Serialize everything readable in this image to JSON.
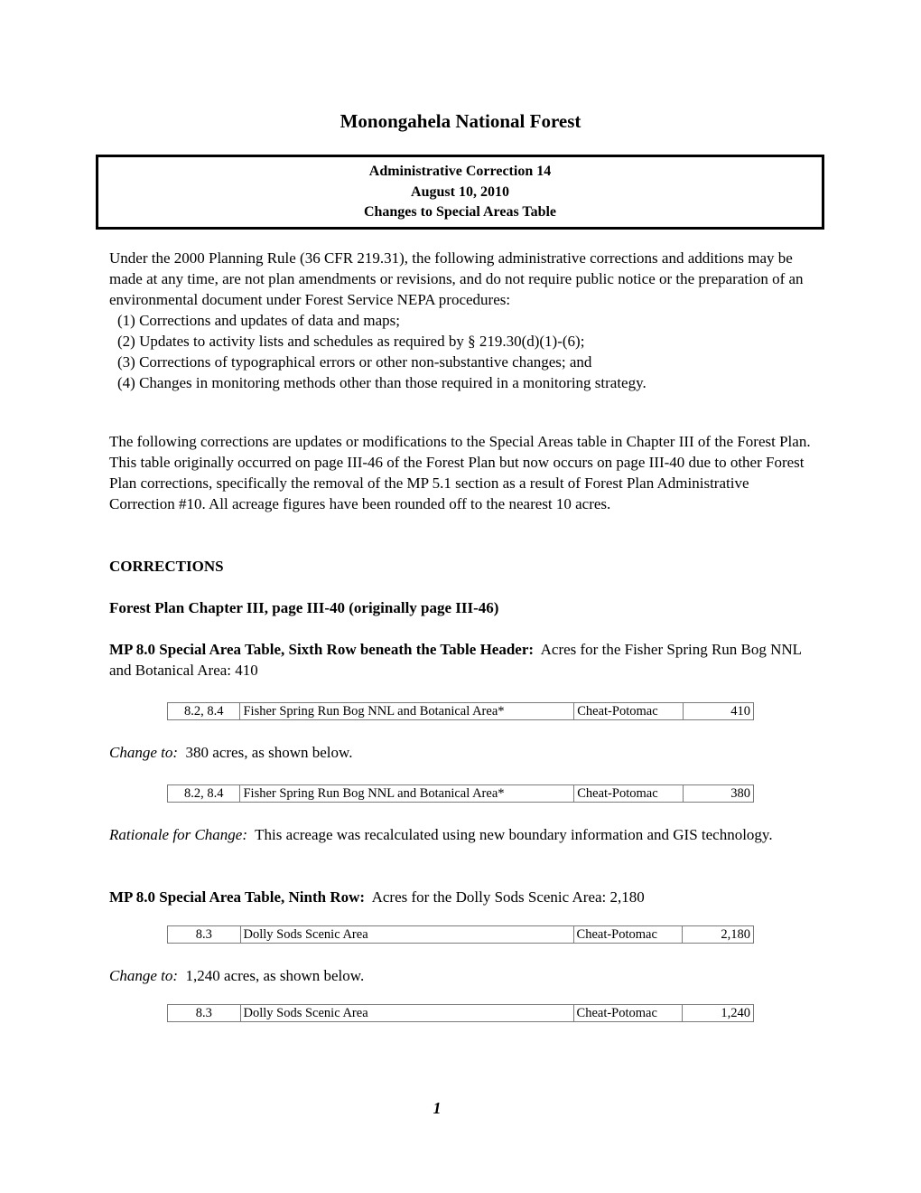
{
  "document": {
    "title": "Monongahela National Forest",
    "header_box": {
      "line1": "Administrative Correction 14",
      "line2": "August 10, 2010",
      "line3": "Changes to Special Areas Table"
    },
    "intro": {
      "text": "Under the 2000 Planning Rule (36 CFR 219.31), the following administrative corrections and additions may be made at any time, are not plan amendments or revisions, and do not require public notice or the preparation of an environmental document under Forest Service NEPA procedures:",
      "items": [
        "(1) Corrections and updates of data and maps;",
        "(2) Updates to activity lists and schedules as required by § 219.30(d)(1)-(6);",
        "(3) Corrections of typographical errors or other non-substantive changes; and",
        "(4) Changes in monitoring methods other than those required in a monitoring strategy."
      ]
    },
    "background": "The following corrections are updates or modifications to the Special Areas table in Chapter III of the Forest Plan.  This table originally occurred on page III-46 of the Forest Plan but now occurs on page III-40 due to other Forest Plan corrections, specifically the removal of the MP 5.1 section as a result of Forest Plan Administrative Correction #10.  All acreage figures have been rounded off to the nearest 10 acres.",
    "corrections_heading": "CORRECTIONS",
    "location_heading": "Forest Plan Chapter III, page III-40 (originally page III-46)",
    "correction1": {
      "label": "MP 8.0 Special Area Table, Sixth Row beneath the Table Header:",
      "text": "  Acres for the Fisher Spring Run Bog NNL and Botanical Area: 410",
      "original_row": [
        "8.2, 8.4",
        "Fisher Spring Run Bog NNL and Botanical Area*",
        "Cheat-Potomac",
        "410"
      ],
      "change_label": "Change to:",
      "change_text": "  380 acres, as shown below.",
      "new_row": [
        "8.2, 8.4",
        "Fisher Spring Run Bog NNL and Botanical Area*",
        "Cheat-Potomac",
        "380"
      ],
      "rationale_label": "Rationale for Change:",
      "rationale_text": "  This acreage was recalculated using new boundary information and GIS technology."
    },
    "correction2": {
      "label": "MP 8.0 Special Area Table, Ninth Row:",
      "text": "  Acres for the Dolly Sods Scenic Area: 2,180",
      "original_row": [
        "8.3",
        "Dolly Sods Scenic Area",
        "Cheat-Potomac",
        "2,180"
      ],
      "change_label": "Change to:",
      "change_text": "  1,240 acres, as shown below.",
      "new_row": [
        "8.3",
        "Dolly Sods Scenic Area",
        "Cheat-Potomac",
        "1,240"
      ]
    },
    "page_number": "1"
  }
}
